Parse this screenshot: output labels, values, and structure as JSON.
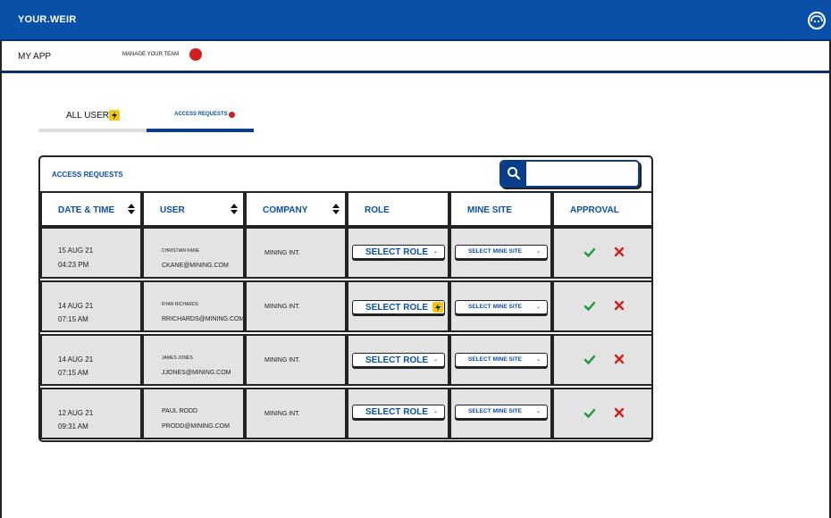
{
  "header": {
    "brand": "YOUR.WEIR",
    "icon": "profile-icon"
  },
  "subnav": {
    "app_label": "MY APP",
    "manage_label": "MANAGE YOUR TEAM"
  },
  "tabs": [
    {
      "label": "ALL USERS",
      "icon": "lightning-icon"
    },
    {
      "label": "ACCESS REQUESTS",
      "badge": "red-dot"
    }
  ],
  "card": {
    "title": "ACCESS REQUESTS",
    "search": {
      "value": "",
      "icon": "search-icon"
    }
  },
  "columns": [
    "DATE & TIME",
    "USER",
    "COMPANY",
    "ROLE",
    "MINE SITE",
    "APPROVAL"
  ],
  "rows": [
    {
      "date": "15 AUG 21",
      "time": "04:23 PM",
      "name": "CHRISTIAN KANE",
      "email": "CKANE@MINING.COM",
      "company": "MINING INT.",
      "role": "SELECT ROLE",
      "site": "SELECT MINE SITE"
    },
    {
      "date": "14 AUG 21",
      "time": "07:15 AM",
      "name": "RYAN RICHARDS",
      "email": "RRICHARDS@MINING.COM",
      "company": "MINING INT.",
      "role": "SELECT ROLE",
      "site": "SELECT MINE SITE"
    },
    {
      "date": "14 AUG 21",
      "time": "07:15 AM",
      "name": "JAMES JONES",
      "email": "JJONES@MINING.COM",
      "company": "MINING INT.",
      "role": "SELECT ROLE",
      "site": "SELECT MINE SITE"
    },
    {
      "date": "12 AUG 21",
      "time": "09:31 AM",
      "name": "PAUL RODD",
      "email": "PRODD@MINING.COM",
      "company": "MINING INT.",
      "role": "SELECT ROLE",
      "site": "SELECT MINE SITE"
    }
  ],
  "colors": {
    "primary": "#0a4fa8",
    "accent_red": "#d01f1f",
    "approve": "#1a9a3c",
    "reject": "#d01f1f",
    "warning": "#f5c518"
  }
}
